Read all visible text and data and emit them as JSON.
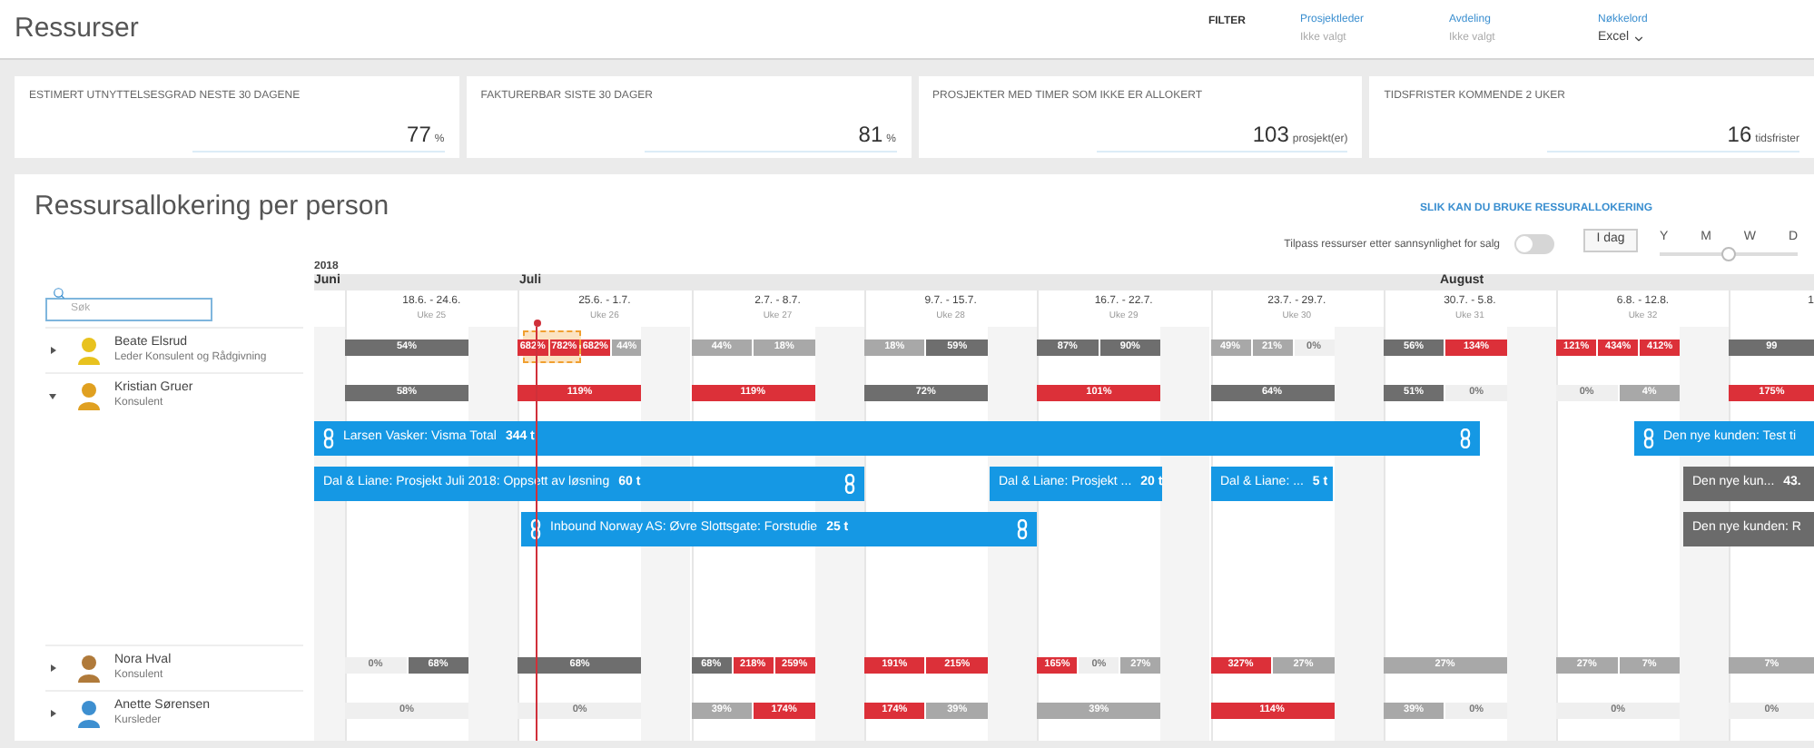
{
  "header": {
    "title": "Ressurser",
    "filter_label": "FILTER",
    "filters": [
      {
        "label": "Prosjektleder",
        "placeholder": "Ikke valgt"
      },
      {
        "label": "Avdeling",
        "placeholder": "Ikke valgt"
      },
      {
        "label": "Nøkkelord",
        "value": "Excel"
      }
    ]
  },
  "kpis": [
    {
      "title": "ESTIMERT UTNYTTELSESGRAD NESTE 30 DAGENE",
      "value": "77",
      "unit": "%"
    },
    {
      "title": "FAKTURERBAR SISTE 30 DAGER",
      "value": "81",
      "unit": "%"
    },
    {
      "title": "PROSJEKTER MED TIMER SOM IKKE ER ALLOKERT",
      "value": "103",
      "unit": "prosjekt(er)"
    },
    {
      "title": "TIDSFRISTER KOMMENDE 2 UKER",
      "value": "16",
      "unit": "tidsfrister"
    }
  ],
  "allocation": {
    "title": "Ressursallokering per person",
    "help_link": "SLIK KAN DU BRUKE RESSURALLOKERING",
    "toggle": {
      "label": "Tilpass ressurser etter sannsynlighet for salg",
      "on": false
    },
    "today_button": "I dag",
    "zoom": {
      "labels": [
        "Y",
        "M",
        "W",
        "D"
      ],
      "level": 0.5
    },
    "search": {
      "placeholder": "Søk"
    },
    "year": "2018",
    "months": [
      "Juni",
      "Juli",
      "August"
    ],
    "weeks": [
      {
        "dates": "18.6. - 24.6.",
        "week": "Uke 25"
      },
      {
        "dates": "25.6. - 1.7.",
        "week": "Uke 26"
      },
      {
        "dates": "2.7. - 8.7.",
        "week": "Uke 27"
      },
      {
        "dates": "9.7. - 15.7.",
        "week": "Uke 28"
      },
      {
        "dates": "16.7. - 22.7.",
        "week": "Uke 29"
      },
      {
        "dates": "23.7. - 29.7.",
        "week": "Uke 30"
      },
      {
        "dates": "30.7. - 5.8.",
        "week": "Uke 31"
      },
      {
        "dates": "6.8. - 12.8.",
        "week": "Uke 32"
      },
      {
        "dates": "1"
      }
    ],
    "people": [
      {
        "name": "Beate Elsrud",
        "role": "Leder Konsulent og Rådgivning",
        "expanded": false,
        "weeks": [
          [
            {
              "label": "54%",
              "kind": "dark"
            }
          ],
          [
            {
              "label": "682%",
              "kind": "over"
            },
            {
              "label": "782%",
              "kind": "over"
            },
            {
              "label": "682%",
              "kind": "over"
            },
            {
              "label": "44%",
              "kind": "light"
            }
          ],
          [
            {
              "label": "44%",
              "kind": "light"
            },
            {
              "label": "18%",
              "kind": "light"
            }
          ],
          [
            {
              "label": "18%",
              "kind": "light"
            },
            {
              "label": "59%",
              "kind": "dark"
            }
          ],
          [
            {
              "label": "87%",
              "kind": "dark"
            },
            {
              "label": "90%",
              "kind": "dark"
            }
          ],
          [
            {
              "label": "49%",
              "kind": "light"
            },
            {
              "label": "21%",
              "kind": "light"
            },
            {
              "label": "0%",
              "kind": "empty"
            }
          ],
          [
            {
              "label": "56%",
              "kind": "dark"
            },
            {
              "label": "134%",
              "kind": "over"
            }
          ],
          [
            {
              "label": "121%",
              "kind": "over"
            },
            {
              "label": "434%",
              "kind": "over"
            },
            {
              "label": "412%",
              "kind": "over"
            }
          ],
          [
            {
              "label": "99",
              "kind": "dark"
            }
          ]
        ]
      },
      {
        "name": "Kristian Gruer",
        "role": "Konsulent",
        "expanded": true,
        "weeks": [
          [
            {
              "label": "58%",
              "kind": "dark"
            }
          ],
          [
            {
              "label": "119%",
              "kind": "over"
            }
          ],
          [
            {
              "label": "119%",
              "kind": "over"
            }
          ],
          [
            {
              "label": "72%",
              "kind": "dark"
            }
          ],
          [
            {
              "label": "101%",
              "kind": "over"
            }
          ],
          [
            {
              "label": "64%",
              "kind": "dark"
            }
          ],
          [
            {
              "label": "51%",
              "kind": "dark"
            },
            {
              "label": "0%",
              "kind": "empty"
            }
          ],
          [
            {
              "label": "0%",
              "kind": "empty"
            },
            {
              "label": "4%",
              "kind": "light"
            }
          ],
          [
            {
              "label": "175%",
              "kind": "over"
            }
          ]
        ],
        "tasks": [
          {
            "title": "Larsen Vasker: Visma Total",
            "hours": "344 t",
            "color": "#1598e4",
            "link_start": true,
            "link_end": true
          },
          {
            "title": "Den nye kunden: Test ti",
            "color": "#1598e4",
            "link_start": true,
            "link_end": false
          },
          {
            "title": "Dal & Liane: Prosjekt Juli 2018: Oppsett av løsning",
            "hours": "60 t",
            "color": "#1598e4",
            "link_start": false,
            "link_end": true
          },
          {
            "title": "Dal & Liane: Prosjekt ...",
            "hours": "20 t",
            "color": "#1598e4",
            "link_start": false,
            "link_end": false
          },
          {
            "title": "Dal & Liane: ...",
            "hours": "5 t",
            "color": "#1598e4",
            "link_start": false,
            "link_end": false
          },
          {
            "title": "Den nye kun...",
            "hours": "43.",
            "color": "#6b6b6b",
            "link_start": false,
            "link_end": false
          },
          {
            "title": "Inbound Norway AS: Øvre Slottsgate: Forstudie",
            "hours": "25 t",
            "color": "#1598e4",
            "link_start": true,
            "link_end": true
          },
          {
            "title": "Den nye kunden: R",
            "color": "#6b6b6b",
            "link_start": false,
            "link_end": false
          }
        ]
      },
      {
        "name": "Nora Hval",
        "role": "Konsulent",
        "expanded": false,
        "weeks": [
          [
            {
              "label": "0%",
              "kind": "empty"
            },
            {
              "label": "68%",
              "kind": "dark"
            }
          ],
          [
            {
              "label": "68%",
              "kind": "dark"
            }
          ],
          [
            {
              "label": "68%",
              "kind": "dark"
            },
            {
              "label": "218%",
              "kind": "over"
            },
            {
              "label": "259%",
              "kind": "over"
            }
          ],
          [
            {
              "label": "191%",
              "kind": "over"
            },
            {
              "label": "215%",
              "kind": "over"
            }
          ],
          [
            {
              "label": "165%",
              "kind": "over"
            },
            {
              "label": "0%",
              "kind": "empty"
            },
            {
              "label": "27%",
              "kind": "light"
            }
          ],
          [
            {
              "label": "327%",
              "kind": "over"
            },
            {
              "label": "27%",
              "kind": "light"
            }
          ],
          [
            {
              "label": "27%",
              "kind": "light"
            }
          ],
          [
            {
              "label": "27%",
              "kind": "light"
            },
            {
              "label": "7%",
              "kind": "light"
            }
          ],
          [
            {
              "label": "7%",
              "kind": "light"
            }
          ]
        ]
      },
      {
        "name": "Anette Sørensen",
        "role": "Kursleder",
        "expanded": false,
        "weeks": [
          [
            {
              "label": "0%",
              "kind": "empty"
            }
          ],
          [
            {
              "label": "0%",
              "kind": "empty"
            }
          ],
          [
            {
              "label": "39%",
              "kind": "light"
            },
            {
              "label": "174%",
              "kind": "over"
            }
          ],
          [
            {
              "label": "174%",
              "kind": "over"
            },
            {
              "label": "39%",
              "kind": "light"
            }
          ],
          [
            {
              "label": "39%",
              "kind": "light"
            }
          ],
          [
            {
              "label": "114%",
              "kind": "over"
            }
          ],
          [
            {
              "label": "39%",
              "kind": "light"
            },
            {
              "label": "0%",
              "kind": "empty"
            }
          ],
          [
            {
              "label": "0%",
              "kind": "empty"
            }
          ],
          [
            {
              "label": "0%",
              "kind": "empty"
            }
          ]
        ]
      }
    ]
  }
}
